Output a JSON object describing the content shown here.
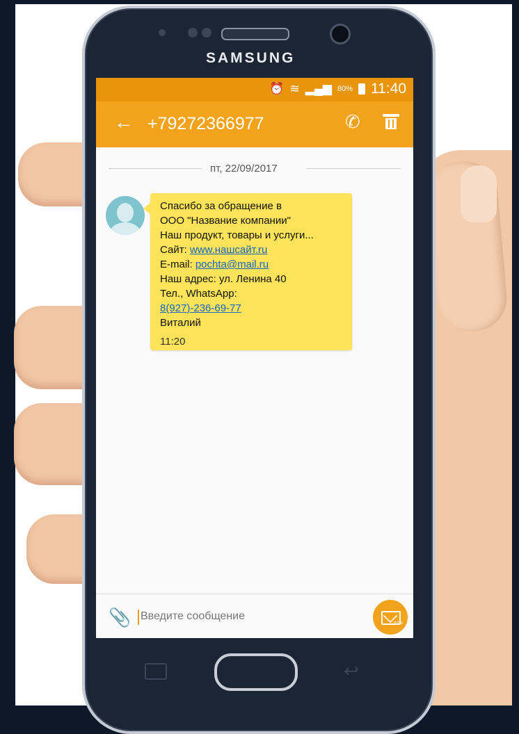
{
  "device": {
    "brand": "SAMSUNG"
  },
  "status_bar": {
    "battery": "80%",
    "time": "11:40"
  },
  "app_bar": {
    "contact": "+79272366977"
  },
  "conversation": {
    "date": "пт, 22/09/2017",
    "message": {
      "lines": [
        "Спасибо за обращение в",
        "ООО \"Название компании\"",
        "Наш продукт, товары и услуги..."
      ],
      "site_label": "Сайт: ",
      "site_link": "www.нашсайт.ru",
      "email_label": "E-mail: ",
      "email_link": "pochta@mail.ru",
      "address": "Наш адрес: ул. Ленина 40",
      "phone_label": "Тел., WhatsApp:",
      "phone_link": "8(927)-236-69-77",
      "signature": "Виталий",
      "time": "11:20"
    }
  },
  "composer": {
    "placeholder": "Введите сообщение",
    "send_badge": "sms"
  },
  "colors": {
    "status_bar": "#e8950c",
    "app_bar": "#f3a21b",
    "bubble": "#fde35a",
    "link": "#1565c0"
  }
}
